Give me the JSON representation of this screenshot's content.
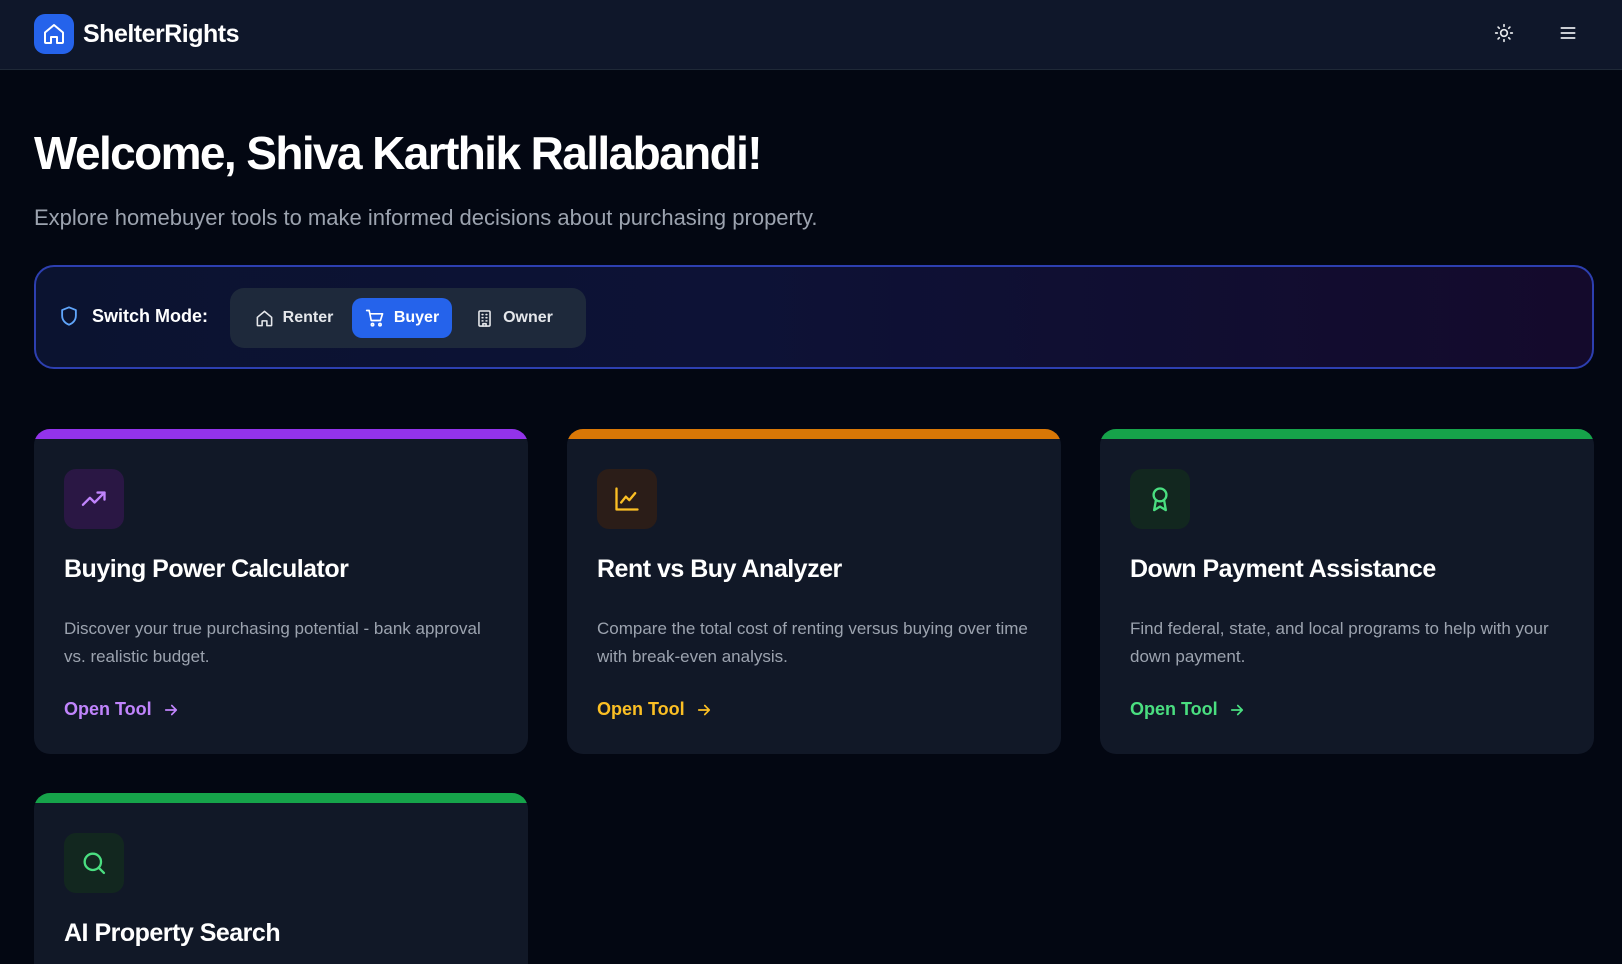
{
  "app": {
    "name": "ShelterRights",
    "logo_icon": "house-icon",
    "brand_color": "#2563eb"
  },
  "header_actions": {
    "theme_icon": "sun-icon",
    "menu_icon": "hamburger-menu-icon"
  },
  "welcome": {
    "title": "Welcome, Shiva Karthik Rallabandi!",
    "subtitle": "Explore homebuyer tools to make informed decisions about purchasing property."
  },
  "mode": {
    "label": "Switch Mode:",
    "label_icon": "shield-icon",
    "options": [
      {
        "label": "Renter",
        "icon": "house-icon",
        "active": false
      },
      {
        "label": "Buyer",
        "icon": "shopping-cart-icon",
        "active": true
      },
      {
        "label": "Owner",
        "icon": "building-icon",
        "active": false
      }
    ]
  },
  "tools": [
    {
      "title": "Buying Power Calculator",
      "description": "Discover your true purchasing potential - bank approval vs. realistic budget.",
      "link": "Open Tool",
      "icon": "trending-up-icon",
      "accent": "#9333ea"
    },
    {
      "title": "Rent vs Buy Analyzer",
      "description": "Compare the total cost of renting versus buying over time with break-even analysis.",
      "link": "Open Tool",
      "icon": "line-chart-icon",
      "accent": "#d97706"
    },
    {
      "title": "Down Payment Assistance",
      "description": "Find federal, state, and local programs to help with your down payment.",
      "link": "Open Tool",
      "icon": "award-ribbon-icon",
      "accent": "#16a34a"
    },
    {
      "title": "AI Property Search",
      "description": "",
      "link": "",
      "icon": "search-icon",
      "accent": "#16a34a"
    }
  ]
}
